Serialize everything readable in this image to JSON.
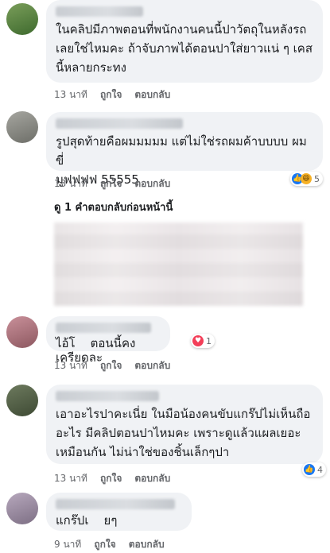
{
  "comments": [
    {
      "text": "ในคลิปมีภาพตอนที่พนักงานคนนี้ปาวัตถุในหลังรถ\nเลยใช่ไหมคะ ถ้าจับภาพได้ตอนปาใส่ยาวแน่ ๆ เคส\nนี้หลายกระทง",
      "time": "13 นาที",
      "like": "ถูกใจ",
      "reply": "ตอบกลับ"
    },
    {
      "text": "รูปสุดท้ายคือผมมมมม แต่ไม่ใช่รถผมค้าบบบบ ผมขี่\nมูฟฟฟฟ 55555",
      "time": "13 นาที",
      "like": "ถูกใจ",
      "reply": "ตอบกลับ",
      "reaction_count": "5",
      "reaction_icons": [
        "like-icon",
        "haha-icon"
      ]
    },
    {
      "text": "ไอ้โ    ตอนนี้คงเครียดละ",
      "time": "13 นาที",
      "like": "ถูกใจ",
      "reply": "ตอบกลับ",
      "reaction_count": "1",
      "reaction_icons": [
        "love-icon"
      ]
    },
    {
      "text": "เอาอะไรปาคะเนี่ย ในมือน้องคนขับแกร๊ปไม่เห็นถือ\nอะไร มีคลิปตอนปาไหมคะ เพราะดูแล้วแผลเยอะ\nเหมือนกัน ไม่น่าใช่ของชิ้นเล็กๆปา",
      "time": "13 นาที",
      "like": "ถูกใจ",
      "reply": "ตอบกลับ",
      "reaction_count": "4",
      "reaction_icons": [
        "like-icon"
      ]
    },
    {
      "text": "แกร๊ปเ    ยๆ",
      "time": "9 นาที",
      "like": "ถูกใจ",
      "reply": "ตอบกลับ"
    }
  ],
  "view_previous_replies": "ดู 1 คำตอบกลับก่อนหน้านี้",
  "colors": {
    "bubble": "#f0f2f5",
    "meta": "#65676b",
    "like_blue": "#1877f2",
    "love_red": "#f33e58",
    "haha_yellow": "#f7b125"
  }
}
